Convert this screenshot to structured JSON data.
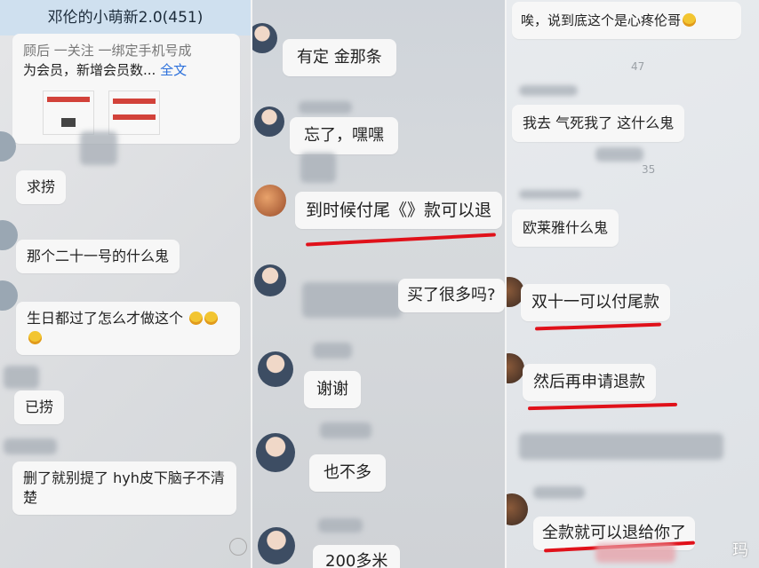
{
  "panel1": {
    "group_title": "邓伦的小萌新2.0(451)",
    "post_preview_line1": "顾后 一关注 一绑定手机号成",
    "post_preview_line2": "为会员，新增会员数...",
    "post_more_link": "全文",
    "messages": [
      "求捞",
      "那个二十一号的什么鬼",
      "生日都过了怎么才做这个",
      "已捞",
      "删了就别提了 hyh皮下脑子不清楚"
    ]
  },
  "panel2": {
    "messages": [
      "有定 金那条",
      "忘了，嘿嘿",
      "到时候付尾《》款可以退",
      "买了很多吗?",
      "谢谢",
      "也不多",
      "200多米"
    ]
  },
  "panel3": {
    "messages": [
      "唉，说到底这个是心疼伦哥",
      "我去 气死我了 这什么鬼",
      "欧莱雅什么鬼",
      "双十一可以付尾款",
      "然后再申请退款",
      "全款就可以退给你了"
    ],
    "timestamps": [
      "47",
      "35"
    ]
  },
  "watermark": "玛",
  "colors": {
    "highlight_line": "#e0111a",
    "link": "#2a6fdb",
    "title_bar": "#cfe0ef"
  },
  "icons": {
    "emoji": "laugh-cry-emoji-icon",
    "input_emoji": "smiley-icon"
  }
}
